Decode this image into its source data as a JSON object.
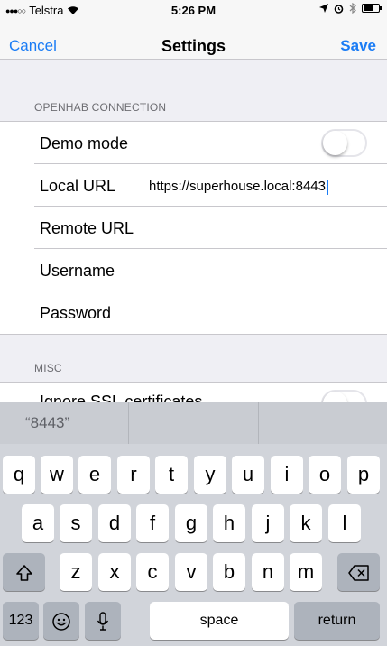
{
  "status_bar": {
    "signal": "●●●○○",
    "carrier": "Telstra",
    "wifi_icon": "wifi-icon",
    "time": "5:26 PM",
    "location_icon": "location-arrow-icon",
    "alarm_icon": "alarm-icon",
    "bluetooth_icon": "bluetooth-icon",
    "battery_icon": "battery-icon"
  },
  "nav": {
    "cancel_label": "Cancel",
    "title": "Settings",
    "save_label": "Save"
  },
  "sections": {
    "openhab": {
      "header": "OPENHAB CONNECTION",
      "demo_mode_label": "Demo mode",
      "demo_mode_on": false,
      "local_url_label": "Local URL",
      "local_url_value": "https://superhouse.local:8443",
      "remote_url_label": "Remote URL",
      "username_label": "Username",
      "password_label": "Password"
    },
    "misc": {
      "header": "MISC",
      "ignore_ssl_label": "Ignore SSL certificates"
    }
  },
  "keyboard": {
    "suggestions": [
      "“8443”",
      "",
      ""
    ],
    "row1": [
      "q",
      "w",
      "e",
      "r",
      "t",
      "y",
      "u",
      "i",
      "o",
      "p"
    ],
    "row2": [
      "a",
      "s",
      "d",
      "f",
      "g",
      "h",
      "j",
      "k",
      "l"
    ],
    "row3": [
      "z",
      "x",
      "c",
      "v",
      "b",
      "n",
      "m"
    ],
    "shift_icon": "shift-icon",
    "backspace_icon": "backspace-icon",
    "numbers_label": "123",
    "emoji_icon": "emoji-icon",
    "mic_icon": "microphone-icon",
    "space_label": "space",
    "return_label": "return"
  },
  "colors": {
    "accent": "#1a7cf5",
    "grouped_background": "#efeff4",
    "keyboard_background": "#d1d4da"
  }
}
